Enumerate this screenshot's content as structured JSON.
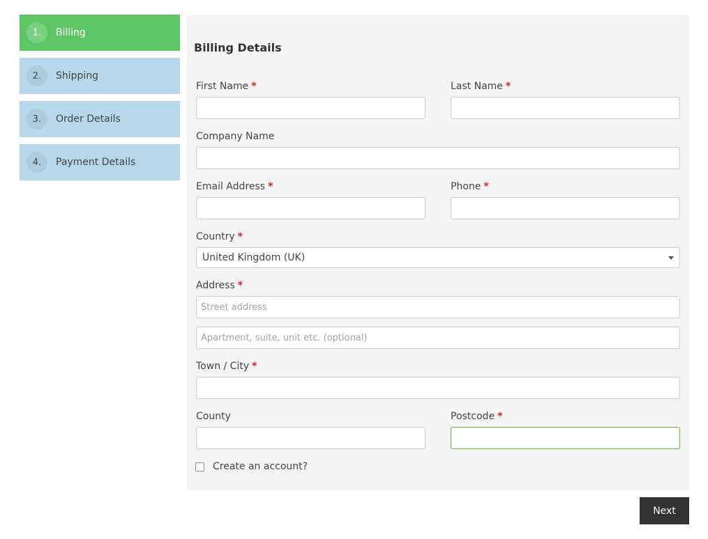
{
  "steps": [
    {
      "number": "1.",
      "label": "Billing",
      "active": true
    },
    {
      "number": "2.",
      "label": "Shipping",
      "active": false
    },
    {
      "number": "3.",
      "label": "Order Details",
      "active": false
    },
    {
      "number": "4.",
      "label": "Payment Details",
      "active": false
    }
  ],
  "form": {
    "title": "Billing Details",
    "required_mark": "*",
    "first_name": {
      "label": "First Name",
      "value": ""
    },
    "last_name": {
      "label": "Last Name",
      "value": ""
    },
    "company_name": {
      "label": "Company Name",
      "value": ""
    },
    "email": {
      "label": "Email Address",
      "value": ""
    },
    "phone": {
      "label": "Phone",
      "value": ""
    },
    "country": {
      "label": "Country",
      "selected": "United Kingdom (UK)"
    },
    "address": {
      "label": "Address",
      "line1_placeholder": "Street address",
      "line2_placeholder": "Apartment, suite, unit etc. (optional)"
    },
    "town_city": {
      "label": "Town / City",
      "value": ""
    },
    "county": {
      "label": "County",
      "value": ""
    },
    "postcode": {
      "label": "Postcode",
      "value": ""
    },
    "create_account": {
      "label": "Create an account?",
      "checked": false
    }
  },
  "actions": {
    "next_label": "Next"
  },
  "colors": {
    "active_step": "#5ec564",
    "inactive_step": "#b6d8ea",
    "required": "#e01c2e",
    "focus_border": "#67b33a",
    "next_button": "#333333"
  }
}
